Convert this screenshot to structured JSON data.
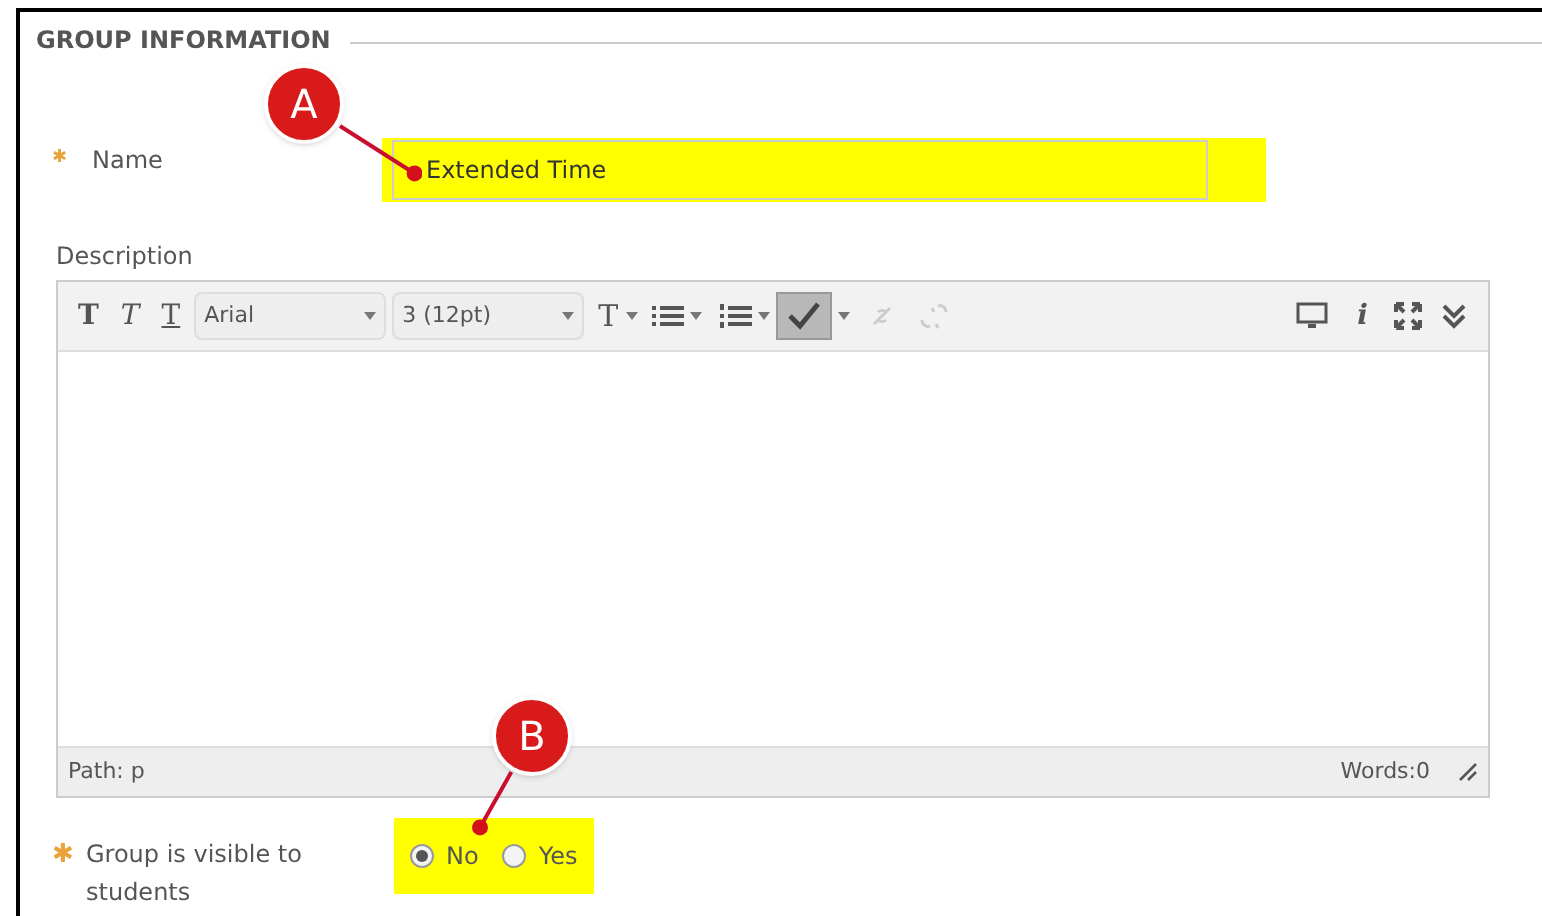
{
  "section_title": "GROUP INFORMATION",
  "name_field": {
    "required_mark": "✱",
    "label": "Name",
    "value": "Extended Time",
    "highlighted": true
  },
  "description": {
    "label": "Description",
    "toolbar": {
      "bold": "T",
      "italic": "T",
      "underline": "T",
      "text_color": "T",
      "info": "i"
    },
    "font": "Arial",
    "size": "3 (12pt)",
    "spellcheck_on": true,
    "path": "Path: p",
    "words": "Words:0"
  },
  "visibility": {
    "required_mark": "✱",
    "label": "Group is visible to students",
    "highlighted": true,
    "options": [
      {
        "label": "No",
        "selected": true
      },
      {
        "label": "Yes",
        "selected": false
      }
    ]
  },
  "callouts": [
    {
      "label": "A"
    },
    {
      "label": "B"
    }
  ]
}
